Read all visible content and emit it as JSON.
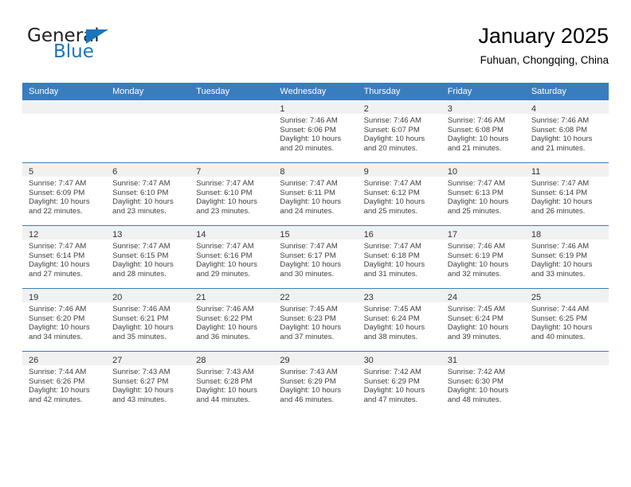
{
  "brand": {
    "name_part1": "General",
    "name_part2": "Blue",
    "logo_icon": "triangle-icon"
  },
  "header": {
    "month_title": "January 2025",
    "location": "Fuhuan, Chongqing, China"
  },
  "colors": {
    "header_blue": "#3a7dbf",
    "brand_blue": "#1b75bb",
    "daystrip_gray": "#f1f1f1",
    "text": "#404040"
  },
  "weekday_headers": [
    "Sunday",
    "Monday",
    "Tuesday",
    "Wednesday",
    "Thursday",
    "Friday",
    "Saturday"
  ],
  "weeks": [
    [
      {
        "day": "",
        "sunrise": "",
        "sunset": "",
        "daylight1": "",
        "daylight2": "",
        "empty": true
      },
      {
        "day": "",
        "sunrise": "",
        "sunset": "",
        "daylight1": "",
        "daylight2": "",
        "empty": true
      },
      {
        "day": "",
        "sunrise": "",
        "sunset": "",
        "daylight1": "",
        "daylight2": "",
        "empty": true
      },
      {
        "day": "1",
        "sunrise": "Sunrise: 7:46 AM",
        "sunset": "Sunset: 6:06 PM",
        "daylight1": "Daylight: 10 hours",
        "daylight2": "and 20 minutes.",
        "empty": false
      },
      {
        "day": "2",
        "sunrise": "Sunrise: 7:46 AM",
        "sunset": "Sunset: 6:07 PM",
        "daylight1": "Daylight: 10 hours",
        "daylight2": "and 20 minutes.",
        "empty": false
      },
      {
        "day": "3",
        "sunrise": "Sunrise: 7:46 AM",
        "sunset": "Sunset: 6:08 PM",
        "daylight1": "Daylight: 10 hours",
        "daylight2": "and 21 minutes.",
        "empty": false
      },
      {
        "day": "4",
        "sunrise": "Sunrise: 7:46 AM",
        "sunset": "Sunset: 6:08 PM",
        "daylight1": "Daylight: 10 hours",
        "daylight2": "and 21 minutes.",
        "empty": false
      }
    ],
    [
      {
        "day": "5",
        "sunrise": "Sunrise: 7:47 AM",
        "sunset": "Sunset: 6:09 PM",
        "daylight1": "Daylight: 10 hours",
        "daylight2": "and 22 minutes.",
        "empty": false
      },
      {
        "day": "6",
        "sunrise": "Sunrise: 7:47 AM",
        "sunset": "Sunset: 6:10 PM",
        "daylight1": "Daylight: 10 hours",
        "daylight2": "and 23 minutes.",
        "empty": false
      },
      {
        "day": "7",
        "sunrise": "Sunrise: 7:47 AM",
        "sunset": "Sunset: 6:10 PM",
        "daylight1": "Daylight: 10 hours",
        "daylight2": "and 23 minutes.",
        "empty": false
      },
      {
        "day": "8",
        "sunrise": "Sunrise: 7:47 AM",
        "sunset": "Sunset: 6:11 PM",
        "daylight1": "Daylight: 10 hours",
        "daylight2": "and 24 minutes.",
        "empty": false
      },
      {
        "day": "9",
        "sunrise": "Sunrise: 7:47 AM",
        "sunset": "Sunset: 6:12 PM",
        "daylight1": "Daylight: 10 hours",
        "daylight2": "and 25 minutes.",
        "empty": false
      },
      {
        "day": "10",
        "sunrise": "Sunrise: 7:47 AM",
        "sunset": "Sunset: 6:13 PM",
        "daylight1": "Daylight: 10 hours",
        "daylight2": "and 25 minutes.",
        "empty": false
      },
      {
        "day": "11",
        "sunrise": "Sunrise: 7:47 AM",
        "sunset": "Sunset: 6:14 PM",
        "daylight1": "Daylight: 10 hours",
        "daylight2": "and 26 minutes.",
        "empty": false
      }
    ],
    [
      {
        "day": "12",
        "sunrise": "Sunrise: 7:47 AM",
        "sunset": "Sunset: 6:14 PM",
        "daylight1": "Daylight: 10 hours",
        "daylight2": "and 27 minutes.",
        "empty": false
      },
      {
        "day": "13",
        "sunrise": "Sunrise: 7:47 AM",
        "sunset": "Sunset: 6:15 PM",
        "daylight1": "Daylight: 10 hours",
        "daylight2": "and 28 minutes.",
        "empty": false
      },
      {
        "day": "14",
        "sunrise": "Sunrise: 7:47 AM",
        "sunset": "Sunset: 6:16 PM",
        "daylight1": "Daylight: 10 hours",
        "daylight2": "and 29 minutes.",
        "empty": false
      },
      {
        "day": "15",
        "sunrise": "Sunrise: 7:47 AM",
        "sunset": "Sunset: 6:17 PM",
        "daylight1": "Daylight: 10 hours",
        "daylight2": "and 30 minutes.",
        "empty": false
      },
      {
        "day": "16",
        "sunrise": "Sunrise: 7:47 AM",
        "sunset": "Sunset: 6:18 PM",
        "daylight1": "Daylight: 10 hours",
        "daylight2": "and 31 minutes.",
        "empty": false
      },
      {
        "day": "17",
        "sunrise": "Sunrise: 7:46 AM",
        "sunset": "Sunset: 6:19 PM",
        "daylight1": "Daylight: 10 hours",
        "daylight2": "and 32 minutes.",
        "empty": false
      },
      {
        "day": "18",
        "sunrise": "Sunrise: 7:46 AM",
        "sunset": "Sunset: 6:19 PM",
        "daylight1": "Daylight: 10 hours",
        "daylight2": "and 33 minutes.",
        "empty": false
      }
    ],
    [
      {
        "day": "19",
        "sunrise": "Sunrise: 7:46 AM",
        "sunset": "Sunset: 6:20 PM",
        "daylight1": "Daylight: 10 hours",
        "daylight2": "and 34 minutes.",
        "empty": false
      },
      {
        "day": "20",
        "sunrise": "Sunrise: 7:46 AM",
        "sunset": "Sunset: 6:21 PM",
        "daylight1": "Daylight: 10 hours",
        "daylight2": "and 35 minutes.",
        "empty": false
      },
      {
        "day": "21",
        "sunrise": "Sunrise: 7:46 AM",
        "sunset": "Sunset: 6:22 PM",
        "daylight1": "Daylight: 10 hours",
        "daylight2": "and 36 minutes.",
        "empty": false
      },
      {
        "day": "22",
        "sunrise": "Sunrise: 7:45 AM",
        "sunset": "Sunset: 6:23 PM",
        "daylight1": "Daylight: 10 hours",
        "daylight2": "and 37 minutes.",
        "empty": false
      },
      {
        "day": "23",
        "sunrise": "Sunrise: 7:45 AM",
        "sunset": "Sunset: 6:24 PM",
        "daylight1": "Daylight: 10 hours",
        "daylight2": "and 38 minutes.",
        "empty": false
      },
      {
        "day": "24",
        "sunrise": "Sunrise: 7:45 AM",
        "sunset": "Sunset: 6:24 PM",
        "daylight1": "Daylight: 10 hours",
        "daylight2": "and 39 minutes.",
        "empty": false
      },
      {
        "day": "25",
        "sunrise": "Sunrise: 7:44 AM",
        "sunset": "Sunset: 6:25 PM",
        "daylight1": "Daylight: 10 hours",
        "daylight2": "and 40 minutes.",
        "empty": false
      }
    ],
    [
      {
        "day": "26",
        "sunrise": "Sunrise: 7:44 AM",
        "sunset": "Sunset: 6:26 PM",
        "daylight1": "Daylight: 10 hours",
        "daylight2": "and 42 minutes.",
        "empty": false
      },
      {
        "day": "27",
        "sunrise": "Sunrise: 7:43 AM",
        "sunset": "Sunset: 6:27 PM",
        "daylight1": "Daylight: 10 hours",
        "daylight2": "and 43 minutes.",
        "empty": false
      },
      {
        "day": "28",
        "sunrise": "Sunrise: 7:43 AM",
        "sunset": "Sunset: 6:28 PM",
        "daylight1": "Daylight: 10 hours",
        "daylight2": "and 44 minutes.",
        "empty": false
      },
      {
        "day": "29",
        "sunrise": "Sunrise: 7:43 AM",
        "sunset": "Sunset: 6:29 PM",
        "daylight1": "Daylight: 10 hours",
        "daylight2": "and 46 minutes.",
        "empty": false
      },
      {
        "day": "30",
        "sunrise": "Sunrise: 7:42 AM",
        "sunset": "Sunset: 6:29 PM",
        "daylight1": "Daylight: 10 hours",
        "daylight2": "and 47 minutes.",
        "empty": false
      },
      {
        "day": "31",
        "sunrise": "Sunrise: 7:42 AM",
        "sunset": "Sunset: 6:30 PM",
        "daylight1": "Daylight: 10 hours",
        "daylight2": "and 48 minutes.",
        "empty": false
      },
      {
        "day": "",
        "sunrise": "",
        "sunset": "",
        "daylight1": "",
        "daylight2": "",
        "empty": true
      }
    ]
  ]
}
